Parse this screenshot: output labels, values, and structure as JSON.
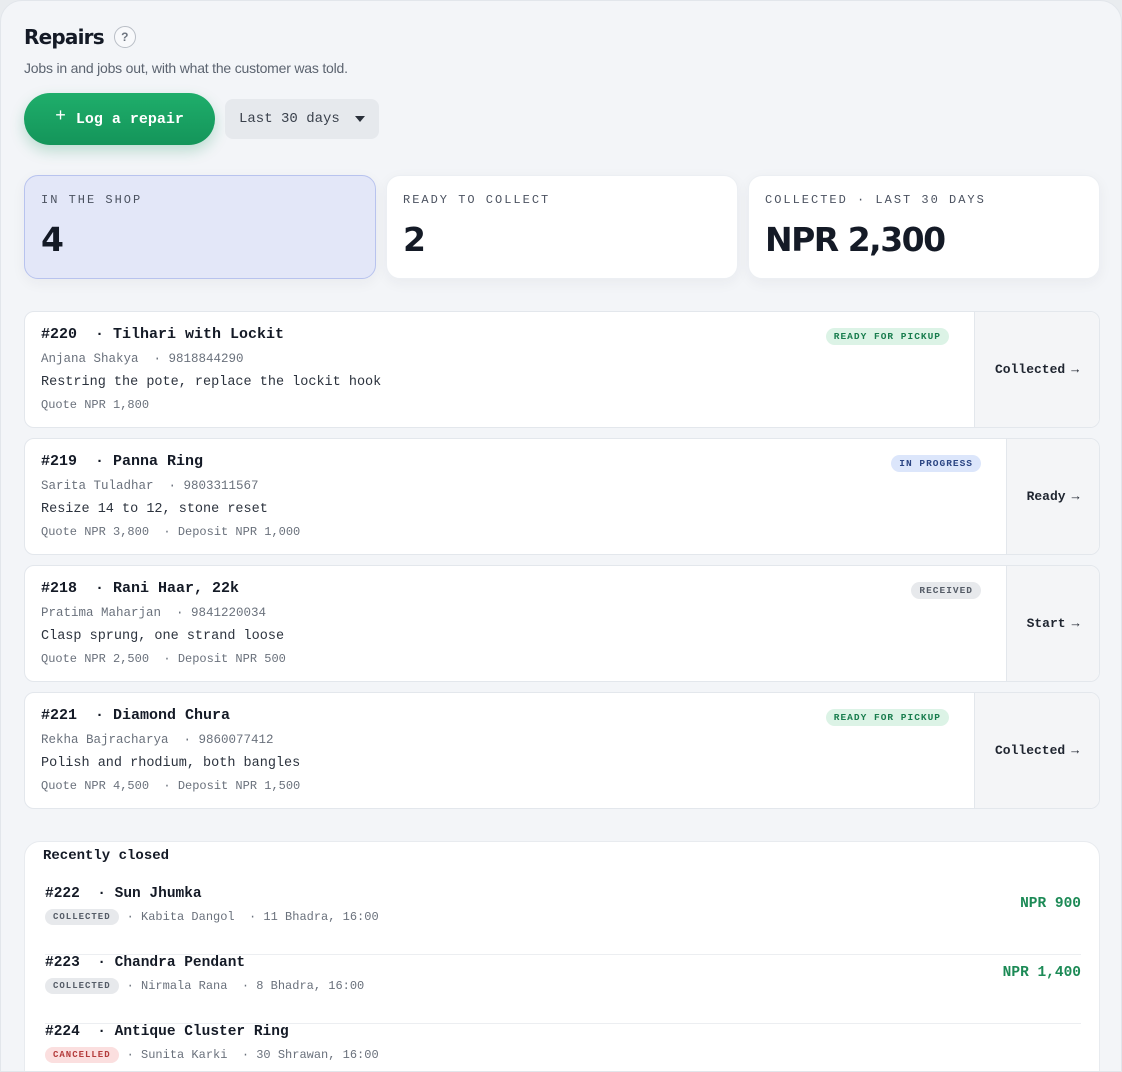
{
  "header": {
    "title": "Repairs",
    "help_label": "?",
    "subtitle": "Jobs in and jobs out, with what the customer was told."
  },
  "toolbar": {
    "log_label": "Log a repair",
    "log_icon": "+",
    "period_value": "Last 30 days"
  },
  "stats": [
    {
      "label": "IN THE SHOP",
      "value": "4"
    },
    {
      "label": "READY TO COLLECT",
      "value": "2"
    },
    {
      "label": "COLLECTED · LAST 30 DAYS",
      "value": "NPR 2,300"
    }
  ],
  "jobs": [
    {
      "title": "#220  · Tilhari with Lockit",
      "customer": "Anjana Shakya  · 9818844290",
      "description": "Restring the pote, replace the lockit hook",
      "money": "Quote NPR 1,800",
      "status": "READY FOR PICKUP",
      "action": "Collected",
      "arrow": "→"
    },
    {
      "title": "#219  · Panna Ring",
      "customer": "Sarita Tuladhar  · 9803311567",
      "description": "Resize 14 to 12, stone reset",
      "money": "Quote NPR 3,800  · Deposit NPR 1,000",
      "status": "IN PROGRESS",
      "action": "Ready",
      "arrow": "→"
    },
    {
      "title": "#218  · Rani Haar, 22k",
      "customer": "Pratima Maharjan  · 9841220034",
      "description": "Clasp sprung, one strand loose",
      "money": "Quote NPR 2,500  · Deposit NPR 500",
      "status": "RECEIVED",
      "action": "Start",
      "arrow": "→"
    },
    {
      "title": "#221  · Diamond Chura",
      "customer": "Rekha Bajracharya  · 9860077412",
      "description": "Polish and rhodium, both bangles",
      "money": "Quote NPR 4,500  · Deposit NPR 1,500",
      "status": "READY FOR PICKUP",
      "action": "Collected",
      "arrow": "→"
    }
  ],
  "recently_closed": {
    "heading": "Recently closed",
    "rows": [
      {
        "title": "#222  · Sun Jhumka",
        "status": "COLLECTED",
        "meta": "· Kabita Dangol  · 11 Bhadra, 16:00",
        "amount": "NPR 900"
      },
      {
        "title": "#223  · Chandra Pendant",
        "status": "COLLECTED",
        "meta": "· Nirmala Rana  · 8 Bhadra, 16:00",
        "amount": "NPR 1,400"
      },
      {
        "title": "#224  · Antique Cluster Ring",
        "status": "CANCELLED",
        "meta": "· Sunita Karki  · 30 Shrawan, 16:00",
        "amount": ""
      }
    ]
  },
  "colors": {
    "accent": "#1fae6b",
    "ready": "#177c4d",
    "in_progress": "#2b4583",
    "received": "#555c67",
    "cancelled": "#b43c3c"
  }
}
